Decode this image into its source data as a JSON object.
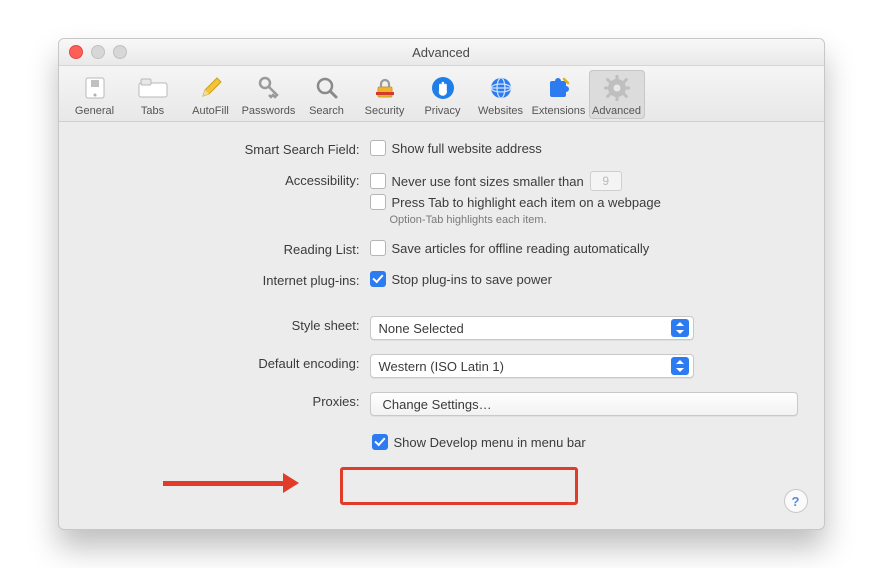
{
  "window": {
    "title": "Advanced"
  },
  "toolbar": {
    "items": [
      {
        "label": "General"
      },
      {
        "label": "Tabs"
      },
      {
        "label": "AutoFill"
      },
      {
        "label": "Passwords"
      },
      {
        "label": "Search"
      },
      {
        "label": "Security"
      },
      {
        "label": "Privacy"
      },
      {
        "label": "Websites"
      },
      {
        "label": "Extensions"
      },
      {
        "label": "Advanced"
      }
    ]
  },
  "smart_search": {
    "label": "Smart Search Field:",
    "show_full_address": {
      "text": "Show full website address",
      "checked": false
    }
  },
  "accessibility": {
    "label": "Accessibility:",
    "font_sizes": {
      "text": "Never use font sizes smaller than",
      "checked": false,
      "value": "9"
    },
    "press_tab": {
      "text": "Press Tab to highlight each item on a webpage",
      "checked": false
    },
    "note": "Option-Tab highlights each item."
  },
  "reading_list": {
    "label": "Reading List:",
    "save_offline": {
      "text": "Save articles for offline reading automatically",
      "checked": false
    }
  },
  "plugins": {
    "label": "Internet plug-ins:",
    "stop_to_save_power": {
      "text": "Stop plug-ins to save power",
      "checked": true
    }
  },
  "style_sheet": {
    "label": "Style sheet:",
    "value": "None Selected"
  },
  "default_encoding": {
    "label": "Default encoding:",
    "value": "Western (ISO Latin 1)"
  },
  "proxies": {
    "label": "Proxies:",
    "button": "Change Settings…"
  },
  "develop": {
    "text": "Show Develop menu in menu bar",
    "checked": true
  },
  "help": "?"
}
